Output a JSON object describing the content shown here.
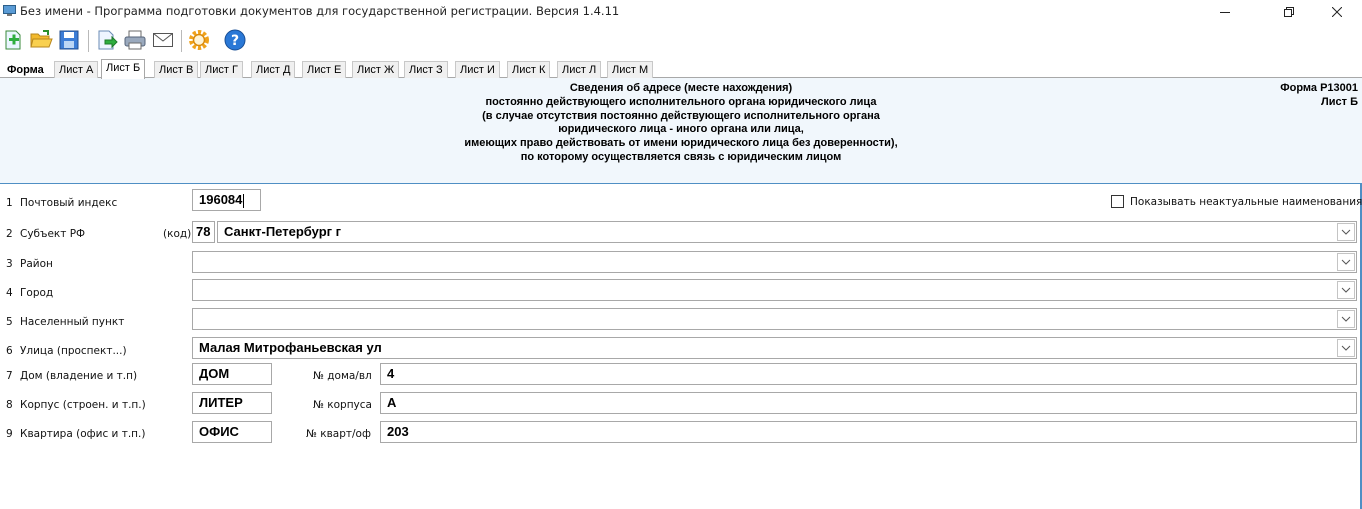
{
  "window": {
    "title": "Без имени - Программа подготовки документов для государственной регистрации. Версия 1.4.11"
  },
  "tabs": [
    {
      "label": "Форма"
    },
    {
      "label": "Лист А"
    },
    {
      "label": "Лист Б"
    },
    {
      "label": "Лист В"
    },
    {
      "label": "Лист Г"
    },
    {
      "label": "Лист Д"
    },
    {
      "label": "Лист Е"
    },
    {
      "label": "Лист Ж"
    },
    {
      "label": "Лист З"
    },
    {
      "label": "Лист И"
    },
    {
      "label": "Лист К"
    },
    {
      "label": "Лист Л"
    },
    {
      "label": "Лист М"
    }
  ],
  "header": {
    "lines": [
      "Сведения об адресе (месте нахождения)",
      "постоянно действующего исполнительного органа юридического лица",
      "(в случае отсутствия постоянно действующего исполнительного органа",
      "юридического лица - иного органа или лица,",
      "имеющих право действовать от имени юридического лица без доверенности),",
      "по которому осуществляется связь с юридическим лицом"
    ],
    "form_code": "Форма Р13001",
    "sheet": "Лист Б"
  },
  "form": {
    "show_obsolete_label": "Показывать неактуальные наименования",
    "code_label": "(код)",
    "rows": [
      {
        "num": "1",
        "label": "Почтовый индекс",
        "value": "196084"
      },
      {
        "num": "2",
        "label": "Субъект РФ",
        "code": "78",
        "value": "Санкт-Петербург г"
      },
      {
        "num": "3",
        "label": "Район",
        "value": ""
      },
      {
        "num": "4",
        "label": "Город",
        "value": ""
      },
      {
        "num": "5",
        "label": "Населенный пункт",
        "value": ""
      },
      {
        "num": "6",
        "label": "Улица (проспект...)",
        "value": "Малая Митрофаньевская ул"
      },
      {
        "num": "7",
        "label": "Дом (владение и т.п)",
        "type": "ДОМ",
        "sub_label": "№ дома/вл",
        "value": "4"
      },
      {
        "num": "8",
        "label": "Корпус (строен. и т.п.)",
        "type": "ЛИТЕР",
        "sub_label": "№ корпуса",
        "value": "А"
      },
      {
        "num": "9",
        "label": "Квартира (офис и т.п.)",
        "type": "ОФИС",
        "sub_label": "№ кварт/оф",
        "value": "203"
      }
    ]
  }
}
